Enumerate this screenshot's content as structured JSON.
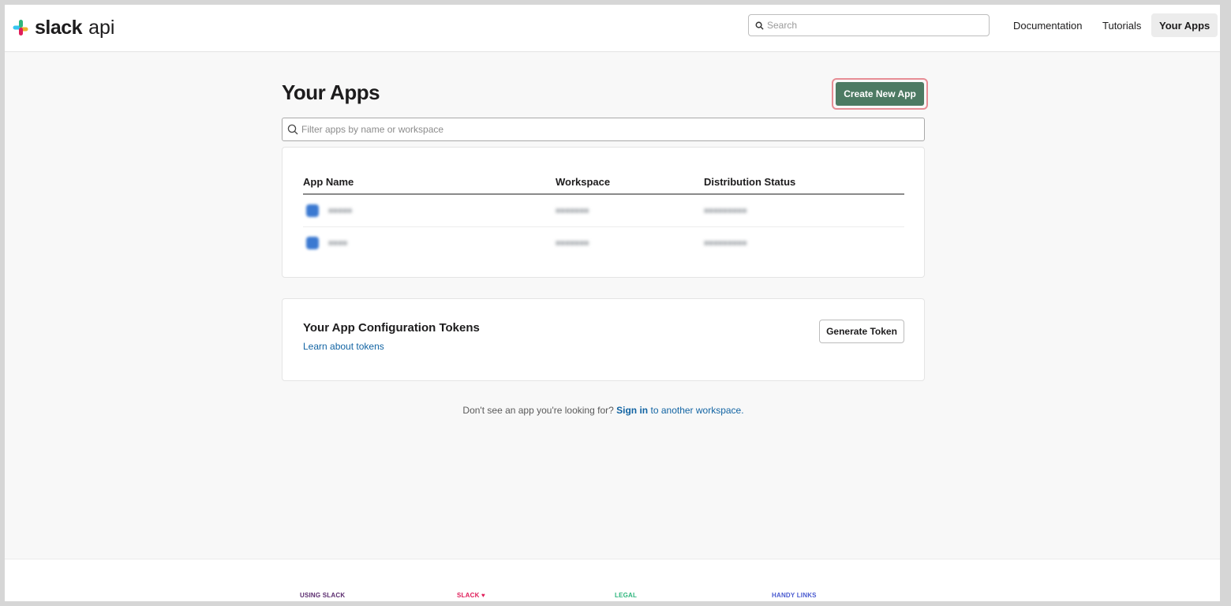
{
  "header": {
    "logo_text": "slack",
    "logo_sub": "api",
    "search_placeholder": "Search",
    "nav": [
      {
        "label": "Documentation"
      },
      {
        "label": "Tutorials"
      },
      {
        "label": "Your Apps"
      }
    ]
  },
  "main": {
    "title": "Your Apps",
    "create_button": "Create New App",
    "filter_placeholder": "Filter apps by name or workspace",
    "table": {
      "headers": [
        "App Name",
        "Workspace",
        "Distribution Status"
      ],
      "rows": [
        {
          "name": "■■■■■",
          "workspace": "■■■■■■■",
          "status": "■■■■■■■■■"
        },
        {
          "name": "■■■■",
          "workspace": "■■■■■■■",
          "status": "■■■■■■■■■"
        }
      ]
    },
    "tokens": {
      "title": "Your App Configuration Tokens",
      "link": "Learn about tokens",
      "button": "Generate Token"
    },
    "hint": {
      "prefix": "Don't see an app you're looking for?",
      "signin": "Sign in",
      "middle": "to",
      "another": "another workspace."
    }
  },
  "footer": {
    "columns": [
      {
        "label": "USING SLACK",
        "color": "#5b2c6f"
      },
      {
        "label": "SLACK ♥",
        "color": "#e01e5a"
      },
      {
        "label": "LEGAL",
        "color": "#2eb67d"
      },
      {
        "label": "HANDY LINKS",
        "color": "#4a5bd0"
      }
    ]
  },
  "colors": {
    "primary_button": "#4d7a63",
    "highlight_border": "#e78d95",
    "link": "#1264a3"
  }
}
